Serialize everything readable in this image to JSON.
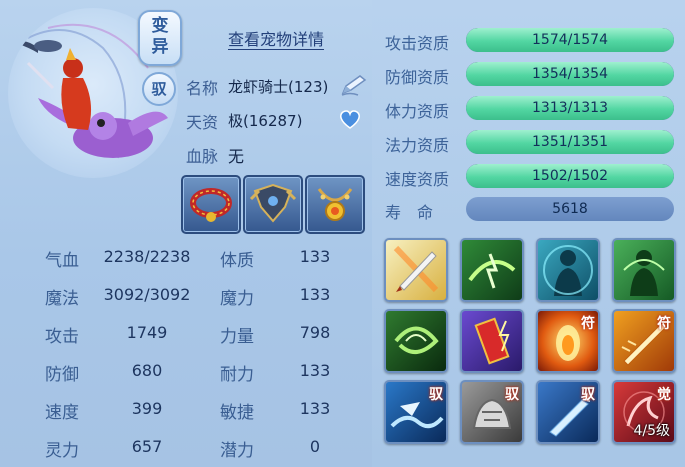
{
  "pet": {
    "detail_link": "查看宠物详情",
    "badge_variant": "变异",
    "badge_tame": "驭",
    "name_label": "名称",
    "name_value": "龙虾骑士(123)",
    "aptitude_label": "天资",
    "aptitude_value": "极(16287)",
    "bloodline_label": "血脉",
    "bloodline_value": "无"
  },
  "equipment": [
    {
      "name": "collar"
    },
    {
      "name": "armor"
    },
    {
      "name": "necklace"
    }
  ],
  "stats_left": [
    {
      "label": "气血",
      "value": "2238/2238"
    },
    {
      "label": "魔法",
      "value": "3092/3092"
    },
    {
      "label": "攻击",
      "value": "1749"
    },
    {
      "label": "防御",
      "value": "680"
    },
    {
      "label": "速度",
      "value": "399"
    },
    {
      "label": "灵力",
      "value": "657"
    }
  ],
  "stats_right": [
    {
      "label": "体质",
      "value": "133"
    },
    {
      "label": "魔力",
      "value": "133"
    },
    {
      "label": "力量",
      "value": "798"
    },
    {
      "label": "耐力",
      "value": "133"
    },
    {
      "label": "敏捷",
      "value": "133"
    },
    {
      "label": "潜力",
      "value": "0"
    }
  ],
  "qualities": [
    {
      "label": "攻击资质",
      "text": "1574/1574",
      "fill": 1.0
    },
    {
      "label": "防御资质",
      "text": "1354/1354",
      "fill": 1.0
    },
    {
      "label": "体力资质",
      "text": "1313/1313",
      "fill": 1.0
    },
    {
      "label": "法力资质",
      "text": "1351/1351",
      "fill": 1.0
    },
    {
      "label": "速度资质",
      "text": "1502/1502",
      "fill": 1.0
    }
  ],
  "lifespan": {
    "label": "寿　命",
    "value": "5618"
  },
  "skills": [
    {
      "name": "sword-slash",
      "tag": "",
      "level": ""
    },
    {
      "name": "wind-strike",
      "tag": "",
      "level": ""
    },
    {
      "name": "spirit-body",
      "tag": "",
      "level": ""
    },
    {
      "name": "green-spirit",
      "tag": "",
      "level": ""
    },
    {
      "name": "wind-vortex",
      "tag": "",
      "level": ""
    },
    {
      "name": "talisman-charge",
      "tag": "",
      "level": ""
    },
    {
      "name": "fire-talisman",
      "tag": "符",
      "level": ""
    },
    {
      "name": "blade-talisman",
      "tag": "符",
      "level": ""
    },
    {
      "name": "wave-tame",
      "tag": "驭",
      "level": ""
    },
    {
      "name": "stone-tame",
      "tag": "驭",
      "level": ""
    },
    {
      "name": "ice-blade-tame",
      "tag": "驭",
      "level": ""
    },
    {
      "name": "awaken",
      "tag": "觉",
      "level": "4/5级"
    }
  ],
  "colors": {
    "accent_bar": "#52d6a2",
    "background": "#b9d3ee",
    "label_text": "#3d6399"
  }
}
